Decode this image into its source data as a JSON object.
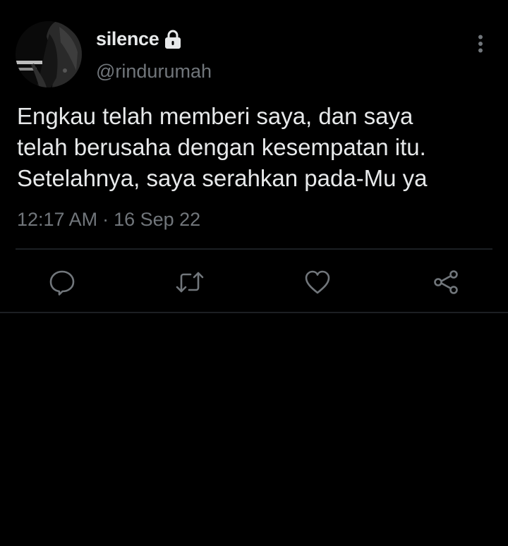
{
  "tweet": {
    "display_name": "silence",
    "handle": "@rindurumah",
    "text": "Engkau telah memberi saya, dan saya\ntelah berusaha dengan kesempatan itu.\nSetelahnya, saya serahkan pada-Mu ya",
    "time": "12:17 AM",
    "separator": "·",
    "date": "16 Sep 22"
  },
  "icons": {
    "lock": "lock-icon",
    "more": "more-vertical-icon",
    "reply": "reply-icon",
    "retweet": "retweet-icon",
    "like": "heart-icon",
    "share": "share-icon"
  },
  "colors": {
    "background": "#000000",
    "text": "#e7e9ea",
    "secondary_text": "#71767b",
    "divider": "#1c1f23"
  }
}
